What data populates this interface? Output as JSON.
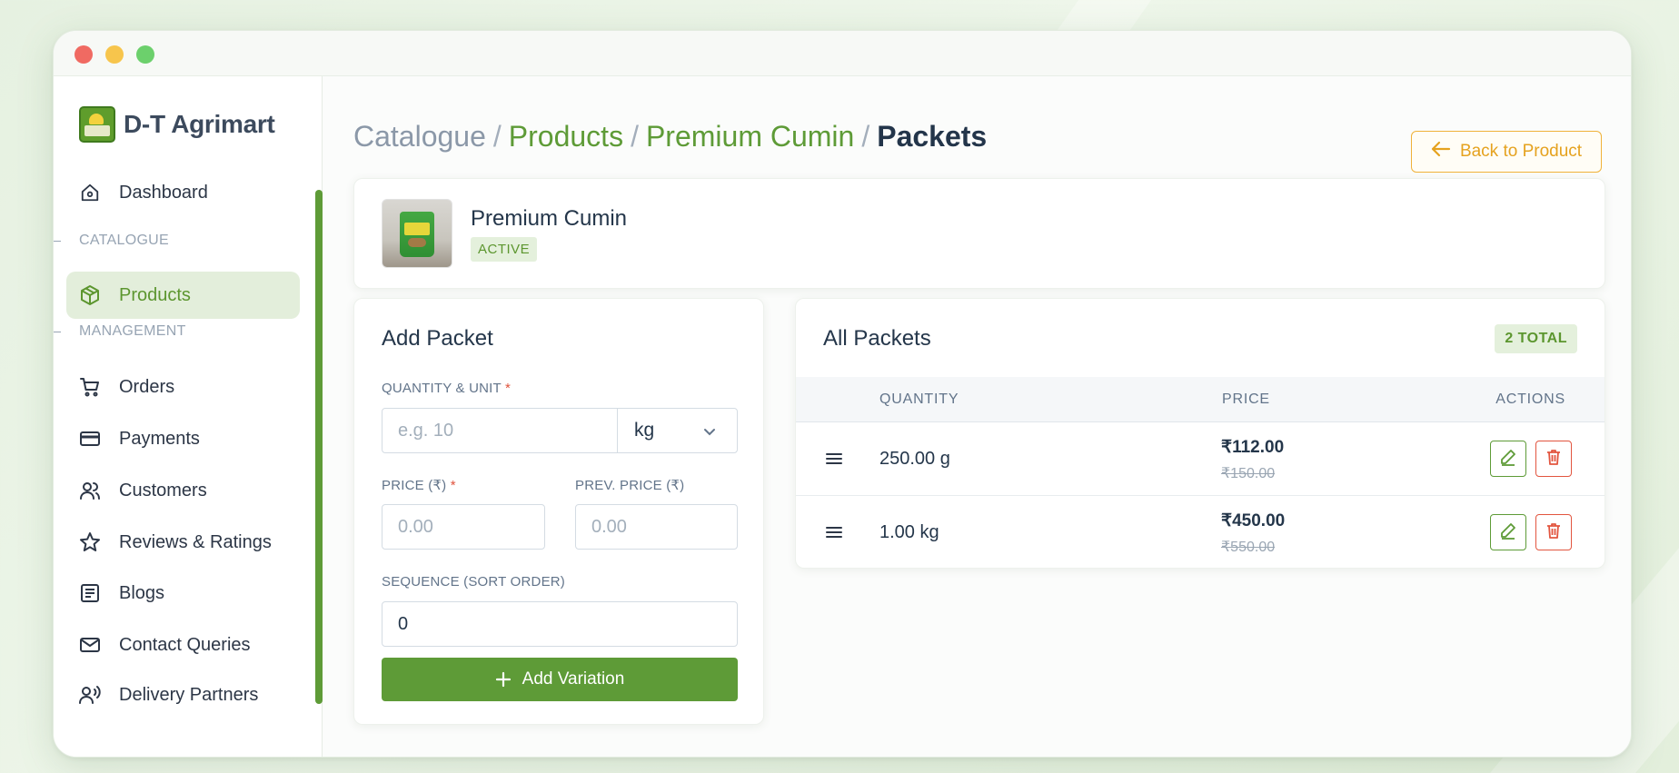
{
  "sidebar": {
    "brand": "D-T Agrimart",
    "items": [
      {
        "label": "Dashboard",
        "icon": "home-icon"
      },
      {
        "label": "Products",
        "icon": "package-icon"
      },
      {
        "label": "Orders",
        "icon": "cart-icon"
      },
      {
        "label": "Payments",
        "icon": "card-icon"
      },
      {
        "label": "Customers",
        "icon": "users-icon"
      },
      {
        "label": "Reviews & Ratings",
        "icon": "star-icon"
      },
      {
        "label": "Blogs",
        "icon": "document-icon"
      },
      {
        "label": "Contact Queries",
        "icon": "mail-icon"
      },
      {
        "label": "Delivery Partners",
        "icon": "delivery-icon"
      }
    ],
    "sections": {
      "catalogue": "CATALOGUE",
      "management": "MANAGEMENT"
    },
    "active": "Products"
  },
  "header": {
    "breadcrumb": [
      "Catalogue",
      "Products",
      "Premium Cumin",
      "Packets"
    ],
    "separator": "/",
    "back_label": "Back to Product"
  },
  "product": {
    "name": "Premium Cumin",
    "status": "ACTIVE"
  },
  "form": {
    "title": "Add Packet",
    "quantity_label": "QUANTITY & UNIT",
    "quantity_placeholder": "e.g. 10",
    "unit_value": "kg",
    "price_label": "PRICE (₹)",
    "price_placeholder": "0.00",
    "prev_price_label": "PREV. PRICE (₹)",
    "prev_price_placeholder": "0.00",
    "sequence_label": "SEQUENCE (SORT ORDER)",
    "sequence_value": "0",
    "required_mark": "*",
    "submit_label": "Add Variation"
  },
  "packets": {
    "title": "All Packets",
    "total_label": "2 TOTAL",
    "columns": [
      "QUANTITY",
      "PRICE",
      "ACTIONS"
    ],
    "rows": [
      {
        "quantity": "250.00 g",
        "price": "₹112.00",
        "prev_price": "₹150.00"
      },
      {
        "quantity": "1.00 kg",
        "price": "₹450.00",
        "prev_price": "₹550.00"
      }
    ]
  },
  "colors": {
    "accent": "#5e9b37",
    "accent_light": "#e3eedb",
    "warning": "#f0b23a",
    "danger": "#e2553f"
  }
}
